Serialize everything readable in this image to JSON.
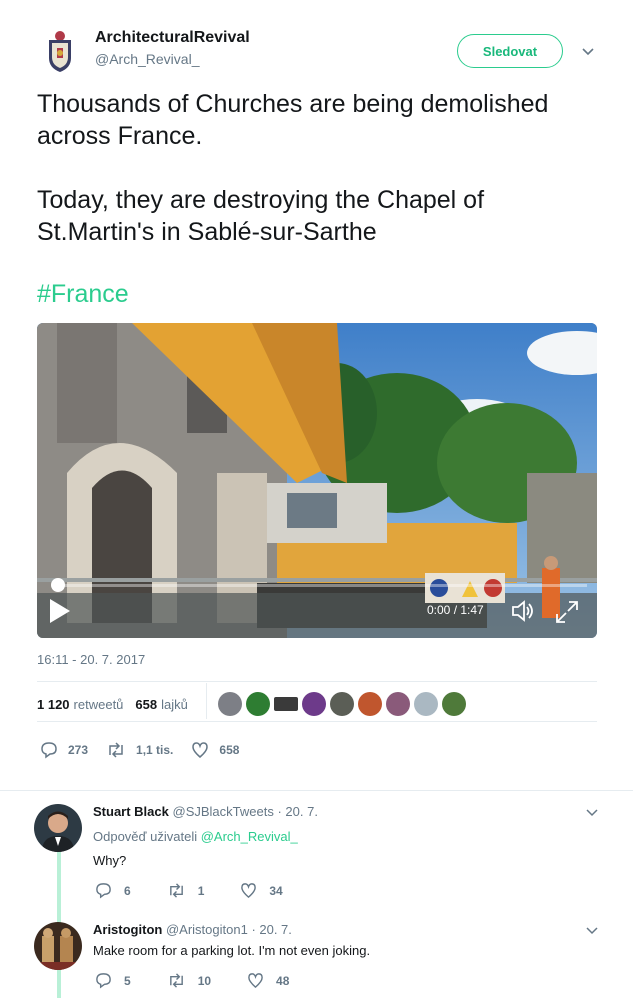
{
  "tweet": {
    "author_name": "ArchitecturalRevival",
    "author_handle": "@Arch_Revival_",
    "follow_label": "Sledovat",
    "text_line1": "Thousands of Churches are being demolished across France.",
    "text_line2": "Today, they are destroying the Chapel of St.Martin's in Sablé-sur-Sarthe",
    "hashtag": "#France",
    "timestamp": "16:11 - 20. 7. 2017",
    "video": {
      "time_display": "0:00 / 1:47",
      "progress": 0
    },
    "stats": {
      "retweets_count": "1 120",
      "retweets_label": "retweetů",
      "likes_count": "658",
      "likes_label": "lajků"
    },
    "actions": {
      "replies": "273",
      "retweets": "1,1 tis.",
      "likes": "658"
    }
  },
  "replies": [
    {
      "name": "Stuart Black",
      "handle": "@SJBlackTweets",
      "date": "· 20. 7.",
      "reply_to_prefix": "Odpověď uživateli",
      "reply_to_handle": "@Arch_Revival_",
      "text": "Why?",
      "counts": {
        "replies": "6",
        "retweets": "1",
        "likes": "34"
      }
    },
    {
      "name": "Aristogiton",
      "handle": "@Aristogiton1",
      "date": "· 20. 7.",
      "text": "Make room for a parking lot. I'm not even joking.",
      "counts": {
        "replies": "5",
        "retweets": "10",
        "likes": "48"
      }
    }
  ],
  "colors": {
    "accent": "#2bcc8e",
    "muted": "#657786",
    "text": "#14171a"
  }
}
